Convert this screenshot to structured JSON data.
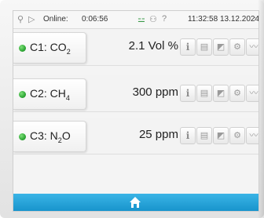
{
  "status": {
    "online_label": "Online:",
    "online_time": "0:06:56",
    "clock": "11:32:58 13.12.2024",
    "icons": [
      "usb-icon",
      "play-icon",
      "network-icon",
      "wifi-icon",
      "help-icon",
      "chevron-icon"
    ]
  },
  "rows": [
    {
      "gas_prefix": "C1: CO",
      "gas_sub": "2",
      "gas_suffix": "",
      "value": "2.1 Vol %",
      "status_color": "#2fa836"
    },
    {
      "gas_prefix": "C2: CH",
      "gas_sub": "4",
      "gas_suffix": "",
      "value": "300 ppm",
      "status_color": "#2fa836"
    },
    {
      "gas_prefix": "C3: N",
      "gas_sub": "2",
      "gas_suffix": "O",
      "value": "25 ppm",
      "status_color": "#2fa836"
    }
  ],
  "row_buttons": [
    "info-icon",
    "document-icon",
    "calibration-icon",
    "gear-icon",
    "trend-icon"
  ],
  "footer": {
    "home_icon": "home-icon",
    "color": "#1fa2d8"
  }
}
